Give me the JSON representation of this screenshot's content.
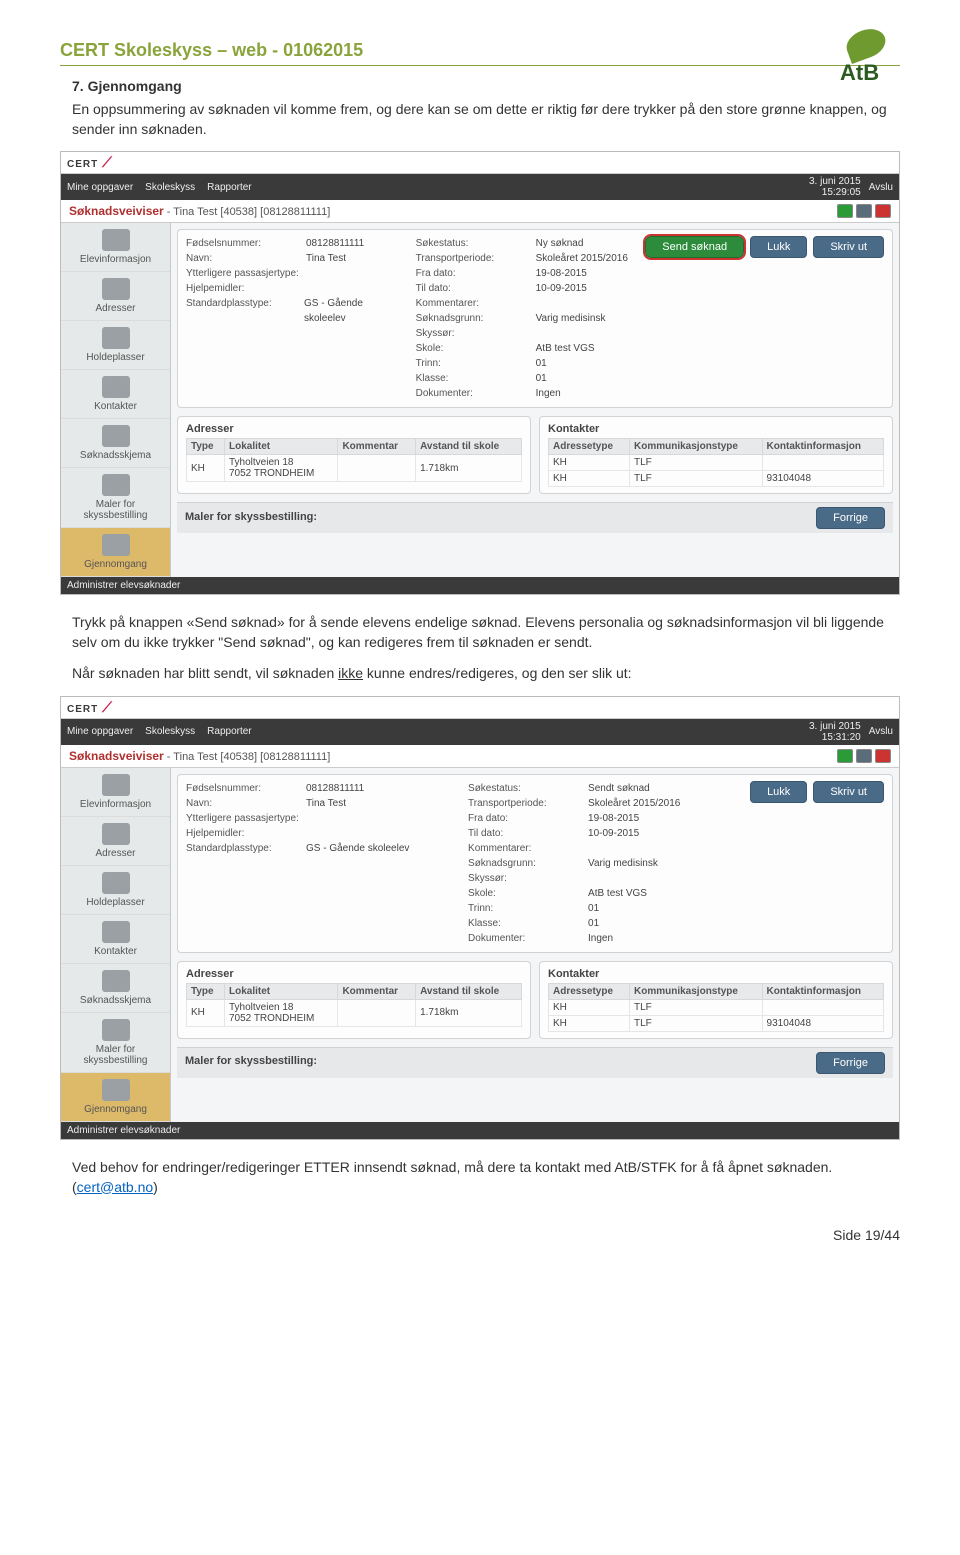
{
  "doc": {
    "header_title": "CERT Skoleskyss – web - 01062015",
    "logo_text": "AtB",
    "section_heading": "7. Gjennomgang",
    "para1": "En oppsummering av søknaden vil komme frem, og dere kan se om dette er riktig før dere trykker på den store grønne knappen, og sender inn søknaden.",
    "para2a": "Trykk på knappen «Send søknad» for å sende elevens endelige søknad. Elevens personalia og søknadsinformasjon vil bli liggende selv om du ikke trykker \"Send søknad\", og kan redigeres frem til søknaden er sendt.",
    "para3_pre": "Når søknaden har blitt sendt, vil søknaden ",
    "para3_u": "ikke",
    "para3_post": " kunne endres/redigeres, og den ser slik ut:",
    "para4": "Ved behov for endringer/redigeringer ETTER innsendt søknad, må dere ta kontakt med AtB/STFK for å få åpnet søknaden. (",
    "email": "cert@atb.no",
    "para4_end": ")",
    "page_number": "Side 19/44"
  },
  "shot_common": {
    "brand": "CERT",
    "topbar_menu": [
      "Mine oppgaver",
      "Skoleskyss",
      "Rapporter"
    ],
    "topbar_right": "Avslu",
    "admin_label": "Administrer elevsøknader",
    "wizard_label": "Søknadsveiviser",
    "wizard_sub": " - Tina Test [40538] [08128811111]"
  },
  "sidebar_items": [
    "Elevinformasjon",
    "Adresser",
    "Holdeplasser",
    "Kontakter",
    "Søknadsskjema",
    "Maler for skyssbestilling",
    "Gjennomgang"
  ],
  "details_left": [
    {
      "k": "Fødselsnummer:",
      "v": "08128811111"
    },
    {
      "k": "Navn:",
      "v": "Tina Test"
    },
    {
      "k": "Ytterligere passasjertype:",
      "v": ""
    },
    {
      "k": "Hjelpemidler:",
      "v": ""
    },
    {
      "k": "Standardplasstype:",
      "v": "GS - Gående skoleelev"
    }
  ],
  "details_right1": [
    {
      "k": "Søkestatus:",
      "v": "Ny søknad"
    },
    {
      "k": "Transportperiode:",
      "v": "Skoleåret 2015/2016"
    },
    {
      "k": "Fra dato:",
      "v": "19-08-2015"
    },
    {
      "k": "Til dato:",
      "v": "10-09-2015"
    },
    {
      "k": "Kommentarer:",
      "v": ""
    },
    {
      "k": "Søknadsgrunn:",
      "v": "Varig medisinsk"
    },
    {
      "k": "Skyssør:",
      "v": ""
    },
    {
      "k": "Skole:",
      "v": "AtB test VGS"
    },
    {
      "k": "Trinn:",
      "v": "01"
    },
    {
      "k": "Klasse:",
      "v": "01"
    },
    {
      "k": "Dokumenter:",
      "v": "Ingen"
    }
  ],
  "details_right2": [
    {
      "k": "Søkestatus:",
      "v": "Sendt søknad"
    },
    {
      "k": "Transportperiode:",
      "v": "Skoleåret 2015/2016"
    },
    {
      "k": "Fra dato:",
      "v": "19-08-2015"
    },
    {
      "k": "Til dato:",
      "v": "10-09-2015"
    },
    {
      "k": "Kommentarer:",
      "v": ""
    },
    {
      "k": "Søknadsgrunn:",
      "v": "Varig medisinsk"
    },
    {
      "k": "Skyssør:",
      "v": ""
    },
    {
      "k": "Skole:",
      "v": "AtB test VGS"
    },
    {
      "k": "Trinn:",
      "v": "01"
    },
    {
      "k": "Klasse:",
      "v": "01"
    },
    {
      "k": "Dokumenter:",
      "v": "Ingen"
    }
  ],
  "buttons": {
    "send": "Send søknad",
    "lukk": "Lukk",
    "skriv_ut": "Skriv ut",
    "forrige": "Forrige"
  },
  "timestamps": {
    "shot1": "3. juni 2015\n15:29:05",
    "shot2": "3. juni 2015\n15:31:20"
  },
  "addr_panel": {
    "title": "Adresser",
    "cols": [
      "Type",
      "Lokalitet",
      "Kommentar",
      "Avstand til skole"
    ],
    "row": {
      "type": "KH",
      "lok": "Tyholtveien 18\n7052 TRONDHEIM",
      "komm": "",
      "avst": "1.718km"
    }
  },
  "kont_panel": {
    "title": "Kontakter",
    "cols": [
      "Adressetype",
      "Kommunikasjonstype",
      "Kontaktinformasjon"
    ],
    "rows": [
      {
        "a": "KH",
        "b": "TLF",
        "c": ""
      },
      {
        "a": "KH",
        "b": "TLF",
        "c": "93104048"
      }
    ]
  },
  "maler_panel": {
    "title": "Maler for skyssbestilling:"
  }
}
